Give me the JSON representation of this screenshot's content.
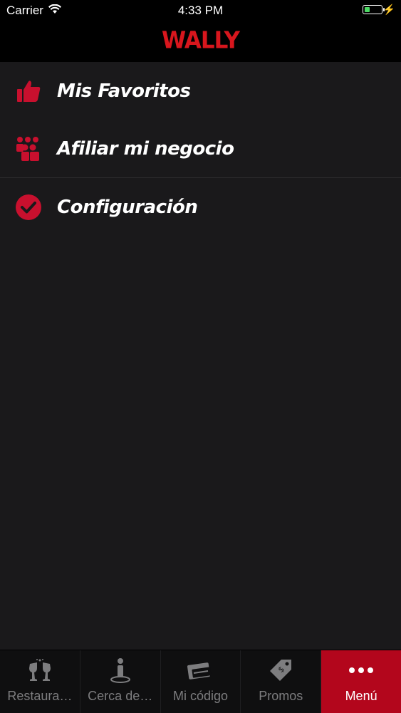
{
  "status_bar": {
    "carrier": "Carrier",
    "time": "4:33 PM",
    "battery_level": 0.35
  },
  "nav": {
    "logo": "WALLY"
  },
  "menu": {
    "items": [
      {
        "label": "Mis Favoritos",
        "icon": "thumbs-up-icon"
      },
      {
        "label": "Afiliar mi negocio",
        "icon": "people-group-icon"
      },
      {
        "label": "Configuración",
        "icon": "check-circle-icon"
      }
    ]
  },
  "tab_bar": {
    "tabs": [
      {
        "label": "Restaura…",
        "icon": "wine-glasses-icon"
      },
      {
        "label": "Cerca de…",
        "icon": "person-location-icon"
      },
      {
        "label": "Mi código",
        "icon": "card-code-icon"
      },
      {
        "label": "Promos",
        "icon": "price-tag-icon"
      },
      {
        "label": "Menú",
        "icon": "more-dots-icon"
      }
    ],
    "active_index": 4
  },
  "colors": {
    "accent": "#b3061c",
    "logo": "#d8161d",
    "background": "#1a191b"
  }
}
